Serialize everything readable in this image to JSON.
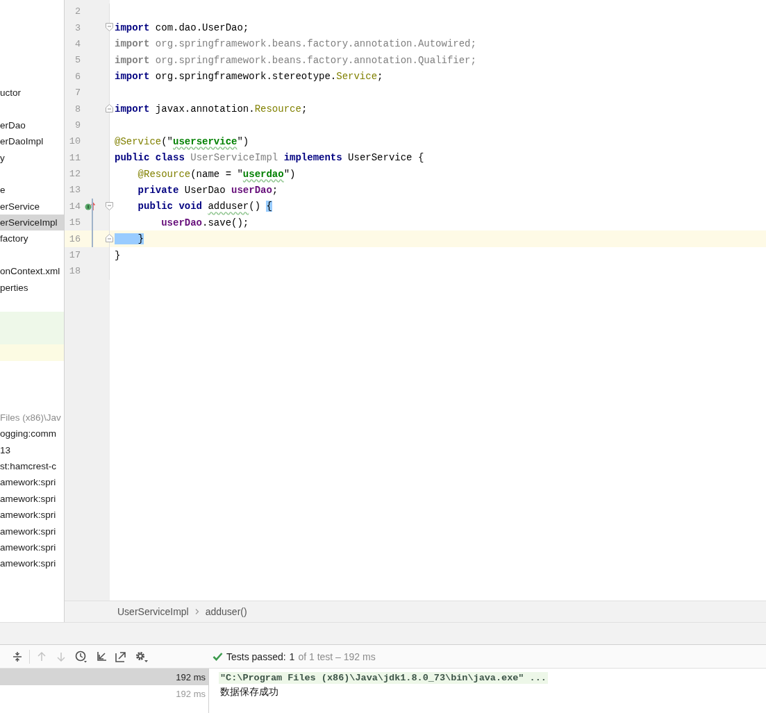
{
  "project_tree": {
    "items": [
      {
        "kind": "blank"
      },
      {
        "kind": "blank"
      },
      {
        "kind": "blank"
      },
      {
        "kind": "blank"
      },
      {
        "kind": "blank"
      },
      {
        "kind": "file",
        "label": "uctor",
        "selected": false,
        "muted": false
      },
      {
        "kind": "blank"
      },
      {
        "kind": "file",
        "label": "erDao",
        "selected": false,
        "muted": false
      },
      {
        "kind": "file",
        "label": "erDaoImpl",
        "selected": false,
        "muted": false
      },
      {
        "kind": "file",
        "label": "y",
        "selected": false,
        "muted": false
      },
      {
        "kind": "blank"
      },
      {
        "kind": "file",
        "label": "e",
        "selected": false,
        "muted": false
      },
      {
        "kind": "file",
        "label": "erService",
        "selected": false,
        "muted": false
      },
      {
        "kind": "file",
        "label": "erServiceImpl",
        "selected": true,
        "muted": false
      },
      {
        "kind": "file",
        "label": "factory",
        "selected": false,
        "muted": false
      },
      {
        "kind": "blank"
      },
      {
        "kind": "file",
        "label": "onContext.xml",
        "selected": false,
        "muted": false
      },
      {
        "kind": "file",
        "label": "perties",
        "selected": false,
        "muted": false
      },
      {
        "kind": "blank"
      },
      {
        "kind": "band",
        "color": "#eef8e9"
      },
      {
        "kind": "band",
        "color": "#eef8e9"
      },
      {
        "kind": "band",
        "color": "#fcfbe3"
      },
      {
        "kind": "blank"
      },
      {
        "kind": "blank"
      },
      {
        "kind": "blank"
      },
      {
        "kind": "file",
        "label": "Files (x86)\\Jav",
        "selected": false,
        "muted": true
      },
      {
        "kind": "file",
        "label": "ogging:comm",
        "selected": false,
        "muted": false
      },
      {
        "kind": "file",
        "label": "13",
        "selected": false,
        "muted": false
      },
      {
        "kind": "file",
        "label": "st:hamcrest-c",
        "selected": false,
        "muted": false
      },
      {
        "kind": "file",
        "label": "amework:spri",
        "selected": false,
        "muted": false
      },
      {
        "kind": "file",
        "label": "amework:spri",
        "selected": false,
        "muted": false
      },
      {
        "kind": "file",
        "label": "amework:spri",
        "selected": false,
        "muted": false
      },
      {
        "kind": "file",
        "label": "amework:spri",
        "selected": false,
        "muted": false
      },
      {
        "kind": "file",
        "label": "amework:spri",
        "selected": false,
        "muted": false
      },
      {
        "kind": "file",
        "label": "amework:spri",
        "selected": false,
        "muted": false
      }
    ]
  },
  "editor": {
    "lines": [
      {
        "number": "2",
        "current": false,
        "changed": false,
        "fold_start": false,
        "fold_end": false
      },
      {
        "number": "3",
        "current": false,
        "changed": false,
        "fold_start": true,
        "fold_end": false,
        "tokens": [
          {
            "kind": "kw",
            "text": "import"
          },
          {
            "kind": "plain",
            "text": " com.dao.UserDao;"
          }
        ]
      },
      {
        "number": "4",
        "current": false,
        "changed": false,
        "fold_start": false,
        "fold_end": false,
        "tokens": [
          {
            "kind": "kwdim",
            "text": "import"
          },
          {
            "kind": "dim",
            "text": " org.springframework.beans.factory.annotation.Autowired;"
          }
        ]
      },
      {
        "number": "5",
        "current": false,
        "changed": false,
        "fold_start": false,
        "fold_end": false,
        "tokens": [
          {
            "kind": "kwdim",
            "text": "import"
          },
          {
            "kind": "dim",
            "text": " org.springframework.beans.factory.annotation.Qualifier;"
          }
        ]
      },
      {
        "number": "6",
        "current": false,
        "changed": false,
        "fold_start": false,
        "fold_end": false,
        "tokens": [
          {
            "kind": "kw",
            "text": "import"
          },
          {
            "kind": "plain",
            "text": " org.springframework.stereotype."
          },
          {
            "kind": "ann",
            "text": "Service"
          },
          {
            "kind": "plain",
            "text": ";"
          }
        ]
      },
      {
        "number": "7",
        "current": false,
        "changed": false,
        "fold_start": false,
        "fold_end": false
      },
      {
        "number": "8",
        "current": false,
        "changed": false,
        "fold_start": false,
        "fold_end": true,
        "tokens": [
          {
            "kind": "kw",
            "text": "import"
          },
          {
            "kind": "plain",
            "text": " javax.annotation."
          },
          {
            "kind": "ann",
            "text": "Resource"
          },
          {
            "kind": "plain",
            "text": ";"
          }
        ]
      },
      {
        "number": "9",
        "current": false,
        "changed": false,
        "fold_start": false,
        "fold_end": false
      },
      {
        "number": "10",
        "current": false,
        "changed": false,
        "fold_start": false,
        "fold_end": false,
        "tokens": [
          {
            "kind": "ann",
            "text": "@Service"
          },
          {
            "kind": "plain",
            "text": "(\""
          },
          {
            "kind": "strtypo",
            "text": "userservice"
          },
          {
            "kind": "plain",
            "text": "\")"
          }
        ]
      },
      {
        "number": "11",
        "current": false,
        "changed": false,
        "fold_start": false,
        "fold_end": false,
        "tokens": [
          {
            "kind": "kw",
            "text": "public class"
          },
          {
            "kind": "dim",
            "text": " UserServiceImpl"
          },
          {
            "kind": "kw",
            "text": " implements"
          },
          {
            "kind": "plain",
            "text": " UserService {"
          }
        ]
      },
      {
        "number": "12",
        "current": false,
        "changed": false,
        "fold_start": false,
        "fold_end": false,
        "tokens": [
          {
            "kind": "ann",
            "text": "    @Resource"
          },
          {
            "kind": "plain",
            "text": "(name = \""
          },
          {
            "kind": "strtypo",
            "text": "userdao"
          },
          {
            "kind": "plain",
            "text": "\")"
          }
        ]
      },
      {
        "number": "13",
        "current": false,
        "changed": false,
        "fold_start": false,
        "fold_end": false,
        "tokens": [
          {
            "kind": "kw",
            "text": "    private"
          },
          {
            "kind": "plain",
            "text": " UserDao "
          },
          {
            "kind": "field",
            "text": "userDao"
          },
          {
            "kind": "plain",
            "text": ";"
          }
        ]
      },
      {
        "number": "14",
        "current": false,
        "changed": true,
        "fold_start": true,
        "fold_end": false,
        "gutter_icon": {
          "kind": "implements"
        },
        "tokens": [
          {
            "kind": "kw",
            "text": "    public void "
          },
          {
            "kind": "typo",
            "text": "adduser"
          },
          {
            "kind": "plain",
            "text": "() "
          },
          {
            "kind": "brace",
            "text": "{"
          }
        ]
      },
      {
        "number": "15",
        "current": false,
        "changed": true,
        "fold_start": false,
        "fold_end": false,
        "tokens": [
          {
            "kind": "field",
            "text": "        userDao"
          },
          {
            "kind": "plain",
            "text": ".save();"
          }
        ]
      },
      {
        "number": "16",
        "current": true,
        "changed": true,
        "fold_start": false,
        "fold_end": true,
        "tokens": [
          {
            "kind": "brace",
            "text": "    }"
          }
        ]
      },
      {
        "number": "17",
        "current": false,
        "changed": false,
        "fold_start": false,
        "fold_end": false,
        "tokens": [
          {
            "kind": "plain",
            "text": "}"
          }
        ]
      },
      {
        "number": "18",
        "current": false,
        "changed": false,
        "fold_start": false,
        "fold_end": false
      }
    ]
  },
  "breadcrumb": [
    "UserServiceImpl",
    "adduser()"
  ],
  "run_toolbar": [
    {
      "kind": "collapse",
      "disabled": false
    },
    {
      "kind": "up",
      "disabled": true
    },
    {
      "kind": "down",
      "disabled": true
    },
    {
      "kind": "history",
      "disabled": false
    },
    {
      "kind": "import",
      "disabled": false
    },
    {
      "kind": "export",
      "disabled": false
    },
    {
      "kind": "settings",
      "disabled": false
    }
  ],
  "test_status": {
    "passed": true,
    "label": "Tests passed:",
    "count": "1",
    "detail": "of 1 test – 192 ms"
  },
  "test_tree": [
    {
      "duration": "192 ms",
      "selected": true
    },
    {
      "duration": "192 ms",
      "selected": false
    }
  ],
  "console": [
    {
      "kind": "command",
      "text": "\"C:\\Program Files (x86)\\Java\\jdk1.8.0_73\\bin\\java.exe\" ..."
    },
    {
      "kind": "output",
      "text": "数据保存成功"
    }
  ]
}
